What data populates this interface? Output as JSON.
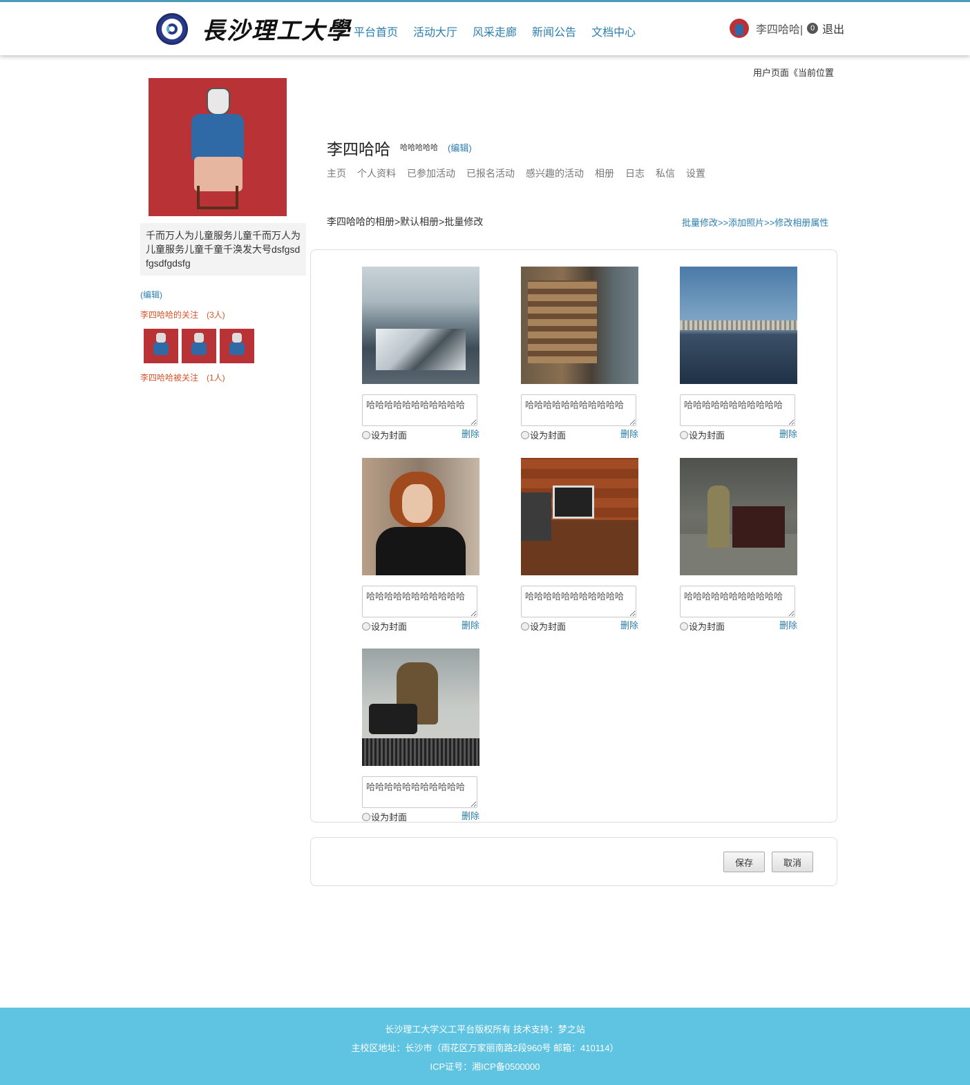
{
  "header": {
    "logo_text": "長沙理工大學",
    "nav": [
      "平台首页",
      "活动大厅",
      "风采走廊",
      "新闻公告",
      "文档中心"
    ],
    "username": "李四哈哈|",
    "badge_count": "0",
    "logout": "退出"
  },
  "breadcrumb": "用户页面《当前位置",
  "sidebar": {
    "bio": "千而万人为儿童服务儿童千而万人为儿童服务儿童千童千涣发大号dsfgsdfgsdfgdsfg",
    "edit": "(编辑)",
    "following_label": "李四哈哈的关注　(3人)",
    "following_count": 3,
    "followers_label": "李四哈哈被关注　(1人)"
  },
  "profile": {
    "name": "李四哈哈",
    "signature": "哈哈哈哈哈",
    "edit": "(编辑)",
    "tabs": [
      "主页",
      "个人资料",
      "已参加活动",
      "已报名活动",
      "感兴趣的活动",
      "相册",
      "日志",
      "私信",
      "设置"
    ]
  },
  "album": {
    "path": "李四哈哈的相册>默认相册>批量修改",
    "actions": "批量修改>>添加照片>>修改相册属性",
    "cover_label": "设为封面",
    "delete_label": "删除",
    "photos": [
      {
        "desc": "哈哈哈哈哈哈哈哈哈哈哈",
        "subject": "city-rooftops-snow"
      },
      {
        "desc": "哈哈哈哈哈哈哈哈哈哈哈",
        "subject": "cliffside-houses"
      },
      {
        "desc": "哈哈哈哈哈哈哈哈哈哈哈",
        "subject": "city-skyline-sea"
      },
      {
        "desc": "哈哈哈哈哈哈哈哈哈哈哈",
        "subject": "woman-portrait"
      },
      {
        "desc": "哈哈哈哈哈哈哈哈哈哈哈",
        "subject": "laptop-on-sofa"
      },
      {
        "desc": "哈哈哈哈哈哈哈哈哈哈哈",
        "subject": "soldier-piano-forest"
      },
      {
        "desc": "哈哈哈哈哈哈哈哈哈哈哈",
        "subject": "man-reading-street"
      }
    ]
  },
  "buttons": {
    "save": "保存",
    "cancel": "取消"
  },
  "footer": {
    "line1": "长沙理工大学义工平台版权所有  技术支持：梦之站",
    "line2": "主校区地址：长沙市（雨花区万家丽南路2段960号 邮箱：410114）",
    "line3": "ICP证号：湘ICP备0500000"
  },
  "colors": {
    "accent": "#2a7fb0",
    "footer_bg": "#5fc3e2",
    "follow_text": "#d9542a",
    "topbar_line": "#4a9bb8"
  }
}
